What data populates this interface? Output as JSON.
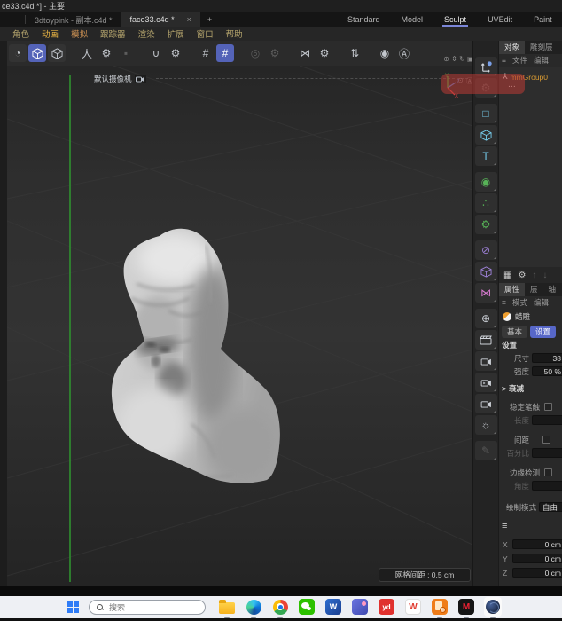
{
  "window": {
    "title": "ce33.c4d *] - 主要"
  },
  "tabs": {
    "inactive": "3dtoypink - 副本.c4d *",
    "active": "face33.c4d *",
    "close_glyph": "×",
    "add_glyph": "+"
  },
  "layouts": {
    "items": [
      "Standard",
      "Model",
      "Sculpt",
      "UVEdit",
      "Paint"
    ],
    "active": "Sculpt"
  },
  "menu": {
    "items": [
      "角色",
      "动画",
      "模拟",
      "跟踪器",
      "渲染",
      "扩展",
      "窗口",
      "帮助"
    ]
  },
  "icons": {
    "arc": "◔",
    "person": "人",
    "gear": "⚙",
    "small_square": "▪",
    "magnet": "∪",
    "grid": "#",
    "rings": "◎",
    "mirror": "⋈",
    "updown": "⇅",
    "hex_dot": "◉",
    "hex_a": "Ⓐ",
    "pan": "⊕",
    "dolly": "⇕",
    "orbit": "↻",
    "maximize": "▣",
    "menu_lines": "≡",
    "grid4": "▦",
    "arrow_up": "↑",
    "arrow_down": "↓",
    "square": "□",
    "text_t": "T",
    "circle_handles": "◉",
    "cluster": "∴",
    "slash_ellipse": "⊘",
    "globe": "⊕",
    "sun": "☼",
    "pencil": "✎",
    "figure": "⅄",
    "dots": "⋯",
    "chevron": ">",
    "magnifier": "⊙"
  },
  "viewport": {
    "camera_label": "默认摄像机",
    "grid_spacing": "网格间距 : 0.5 cm",
    "axis_x": "X",
    "axis_y": "Y",
    "axis_z": "Z"
  },
  "object_panel": {
    "tabs": [
      "对象",
      "雕刻层"
    ],
    "menu": [
      "文件",
      "编辑"
    ],
    "items": [
      {
        "name": "mmGroup0"
      }
    ]
  },
  "attributes": {
    "tabs": [
      "属性",
      "层",
      "轴"
    ],
    "menu": [
      "模式",
      "编辑"
    ],
    "tool_name": "蜡雕",
    "mode_tabs": [
      "基本",
      "设置"
    ],
    "section_settings": "设置",
    "size_label": "尺寸",
    "size_value": "38",
    "strength_label": "强度",
    "strength_value": "50 %",
    "falloff_section": "衰减",
    "steady_label": "稳定笔触",
    "length_label": "长度",
    "spacing_label": "间距",
    "percent_label": "百分比",
    "edge_label": "边缘检测",
    "angle_label": "角度",
    "drawmode_label": "绘制模式",
    "drawmode_value": "自由"
  },
  "coordinates": {
    "x_label": "X",
    "x_value": "0 cm",
    "y_label": "Y",
    "y_value": "0 cm",
    "z_label": "Z",
    "z_value": "0 cm"
  },
  "taskbar": {
    "search_placeholder": "搜索",
    "youdao_label": "yd",
    "wps_label": "W",
    "word_label": "W",
    "mail_label": "M"
  },
  "colors": {
    "accent_blue": "#5463b8",
    "tab_underline": "#7b86d8",
    "object_orange": "#d89a33",
    "axis_green": "#2f8b2f",
    "overlay_red": "#b93a34",
    "taskbar_bg": "#eef0f4"
  }
}
